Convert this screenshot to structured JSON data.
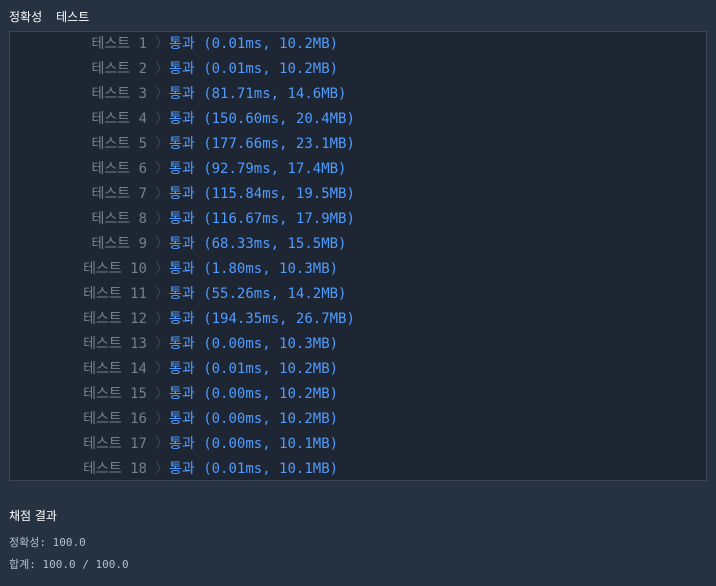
{
  "tabs": {
    "accuracy": "정확성",
    "test": "테스트"
  },
  "tests": [
    {
      "label": "테스트 1",
      "result": "통과 (0.01ms, 10.2MB)"
    },
    {
      "label": "테스트 2",
      "result": "통과 (0.01ms, 10.2MB)"
    },
    {
      "label": "테스트 3",
      "result": "통과 (81.71ms, 14.6MB)"
    },
    {
      "label": "테스트 4",
      "result": "통과 (150.60ms, 20.4MB)"
    },
    {
      "label": "테스트 5",
      "result": "통과 (177.66ms, 23.1MB)"
    },
    {
      "label": "테스트 6",
      "result": "통과 (92.79ms, 17.4MB)"
    },
    {
      "label": "테스트 7",
      "result": "통과 (115.84ms, 19.5MB)"
    },
    {
      "label": "테스트 8",
      "result": "통과 (116.67ms, 17.9MB)"
    },
    {
      "label": "테스트 9",
      "result": "통과 (68.33ms, 15.5MB)"
    },
    {
      "label": "테스트 10",
      "result": "통과 (1.80ms, 10.3MB)"
    },
    {
      "label": "테스트 11",
      "result": "통과 (55.26ms, 14.2MB)"
    },
    {
      "label": "테스트 12",
      "result": "통과 (194.35ms, 26.7MB)"
    },
    {
      "label": "테스트 13",
      "result": "통과 (0.00ms, 10.3MB)"
    },
    {
      "label": "테스트 14",
      "result": "통과 (0.01ms, 10.2MB)"
    },
    {
      "label": "테스트 15",
      "result": "통과 (0.00ms, 10.2MB)"
    },
    {
      "label": "테스트 16",
      "result": "통과 (0.00ms, 10.2MB)"
    },
    {
      "label": "테스트 17",
      "result": "통과 (0.00ms, 10.1MB)"
    },
    {
      "label": "테스트 18",
      "result": "통과 (0.01ms, 10.1MB)"
    }
  ],
  "grading": {
    "title": "채점 결과",
    "accuracy": "정확성: 100.0",
    "total": "합계: 100.0 / 100.0"
  },
  "colors": {
    "background": "#263241",
    "panel": "#1e2634",
    "pass": "#4f9cff",
    "label": "#76808c"
  }
}
